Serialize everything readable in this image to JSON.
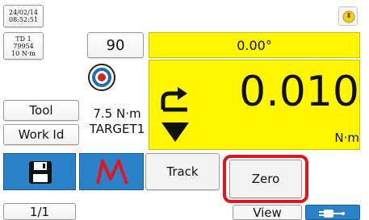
{
  "header": {
    "date": "24/02/14",
    "time": "08:52:51"
  },
  "tool_info": {
    "line1": "TD 1",
    "line2": "79954",
    "line3": "10 N·m"
  },
  "left_buttons": {
    "tool_label": "Tool",
    "work_id_label": "Work Id"
  },
  "target": {
    "count": "90",
    "torque": "7.5 N·m",
    "name": "TARGET1"
  },
  "display": {
    "angle": "0.00°",
    "torque_value": "0.010",
    "torque_unit": "N·m"
  },
  "bottom_bar": {
    "track_label": "Track",
    "zero_label": "Zero",
    "view_label": "View",
    "page_indicator": "1/1"
  },
  "colors": {
    "yellow": "#fff600",
    "blue": "#2c82c9",
    "highlight_red": "#e0161e",
    "curve_red": "#e0161e"
  },
  "icons": [
    "save-icon",
    "curve-icon",
    "target-icon",
    "direction-icon",
    "power-plug-icon",
    "status-icon"
  ]
}
